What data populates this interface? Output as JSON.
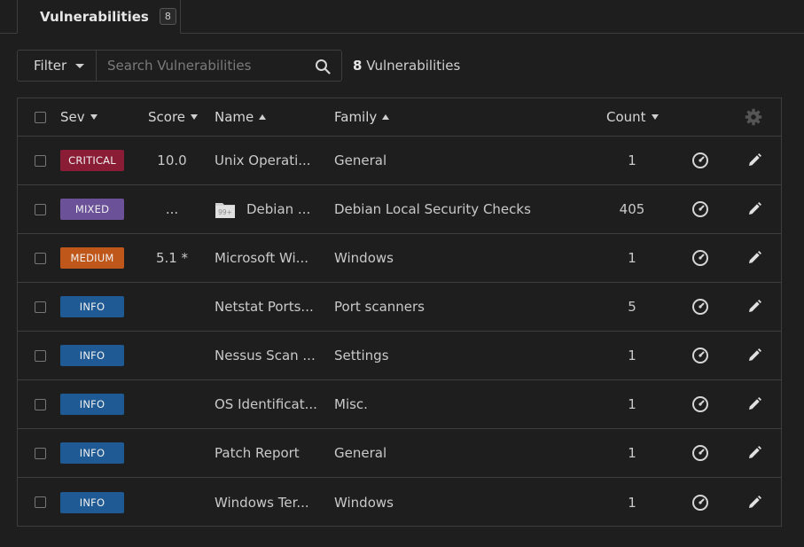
{
  "tab": {
    "label": "Vulnerabilities",
    "count": "8"
  },
  "filter": {
    "label": "Filter"
  },
  "search": {
    "placeholder": "Search Vulnerabilities"
  },
  "summary": {
    "count": "8",
    "label": " Vulnerabilities"
  },
  "columns": {
    "sev": "Sev",
    "score": "Score",
    "name": "Name",
    "family": "Family",
    "count": "Count"
  },
  "colors": {
    "CRITICAL": "#8a1c35",
    "MIXED": "#6b5298",
    "MEDIUM": "#c0571a",
    "INFO": "#1f5a94"
  },
  "icons": {
    "filter_caret": "caret-down",
    "search": "magnifier",
    "settings": "gear",
    "snooze": "clock",
    "edit": "pencil",
    "grouped": "folder"
  },
  "rows": [
    {
      "severity": "CRITICAL",
      "score": "10.0",
      "name": "Unix Operati...",
      "family": "General",
      "count": "1",
      "grouped": false
    },
    {
      "severity": "MIXED",
      "score": "...",
      "name": "Debian ...",
      "family": "Debian Local Security Checks",
      "count": "405",
      "grouped": true,
      "group_badge": "99+"
    },
    {
      "severity": "MEDIUM",
      "score": "5.1 *",
      "name": "Microsoft Wi...",
      "family": "Windows",
      "count": "1",
      "grouped": false
    },
    {
      "severity": "INFO",
      "score": "",
      "name": "Netstat Ports...",
      "family": "Port scanners",
      "count": "5",
      "grouped": false
    },
    {
      "severity": "INFO",
      "score": "",
      "name": "Nessus Scan ...",
      "family": "Settings",
      "count": "1",
      "grouped": false
    },
    {
      "severity": "INFO",
      "score": "",
      "name": "OS Identificat...",
      "family": "Misc.",
      "count": "1",
      "grouped": false
    },
    {
      "severity": "INFO",
      "score": "",
      "name": "Patch Report",
      "family": "General",
      "count": "1",
      "grouped": false
    },
    {
      "severity": "INFO",
      "score": "",
      "name": "Windows Ter...",
      "family": "Windows",
      "count": "1",
      "grouped": false
    }
  ]
}
